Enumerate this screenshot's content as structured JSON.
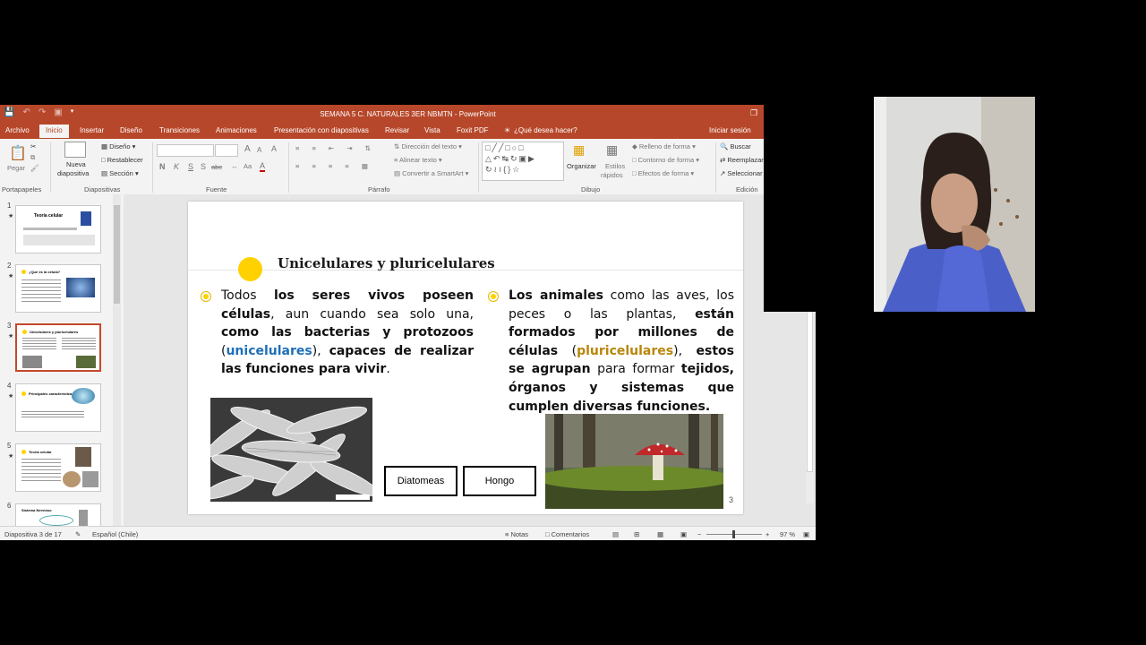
{
  "app": {
    "window_title": "SEMANA 5 C. NATURALES 3ER NBMTN - PowerPoint",
    "tabs": [
      "Archivo",
      "Inicio",
      "Insertar",
      "Diseño",
      "Transiciones",
      "Animaciones",
      "Presentación con diapositivas",
      "Revisar",
      "Vista",
      "Foxit PDF"
    ],
    "active_tab": "Inicio",
    "tell_me": "¿Qué desea hacer?",
    "sign_in": "Iniciar sesión"
  },
  "ribbon": {
    "clipboard": {
      "paste": "Pegar",
      "group": "Portapapeles"
    },
    "slides": {
      "new_slide_1": "Nueva",
      "new_slide_2": "diapositiva",
      "layout": "Diseño",
      "reset": "Restablecer",
      "section": "Sección",
      "group": "Diapositivas"
    },
    "font": {
      "bold": "N",
      "italic": "K",
      "underline": "S",
      "shadow": "S",
      "strike": "abc",
      "grow": "A",
      "shrink": "A",
      "clear": "A",
      "group": "Fuente"
    },
    "paragraph": {
      "text_direction": "Dirección del texto",
      "align_text": "Alinear texto",
      "smartart": "Convertir a SmartArt",
      "group": "Párrafo"
    },
    "drawing": {
      "arrange": "Organizar",
      "quick_styles_1": "Estilos",
      "quick_styles_2": "rápidos",
      "fill": "Relleno de forma",
      "outline": "Contorno de forma",
      "effects": "Efectos de forma",
      "group": "Dibujo"
    },
    "editing": {
      "find": "Buscar",
      "replace": "Reemplazar",
      "select": "Seleccionar",
      "group": "Edición"
    }
  },
  "thumbnails": [
    {
      "num": "1",
      "title": "Teoría celular"
    },
    {
      "num": "2",
      "title": "¿Qué es la célula?"
    },
    {
      "num": "3",
      "title": "Unicelulares y pluricelulares"
    },
    {
      "num": "4",
      "title": "Principales características"
    },
    {
      "num": "5",
      "title": "Teoría celular"
    },
    {
      "num": "6",
      "title": "Sistema Nervioso"
    }
  ],
  "slide": {
    "title": "Unicelulares y pluricelulares",
    "left": {
      "t1": "Todos ",
      "t2": "los seres vivos poseen células",
      "t3": ", aun cuando sea solo una, ",
      "t4": "como las bacterias y protozoos",
      "t5": " (",
      "t6": "unicelulares",
      "t7": "), ",
      "t8": "capaces de realizar las funciones para vivir",
      "t9": "."
    },
    "right": {
      "t1": "Los animales",
      "t2": " como las aves, los peces o las plantas, ",
      "t3": "están formados por millones de células",
      "t4": " (",
      "t5": "pluricelulares",
      "t6": "), ",
      "t7": "estos se agrupan",
      "t8": " para formar ",
      "t9": "tejidos, órganos y sistemas que cumplen diversas funciones."
    },
    "label_1": "Diatomeas",
    "label_2": "Hongo",
    "page_number": "3"
  },
  "status": {
    "slide_info": "Diapositiva 3 de 17",
    "language": "Español (Chile)",
    "notes": "Notas",
    "comments": "Comentarios",
    "zoom": "97 %"
  }
}
